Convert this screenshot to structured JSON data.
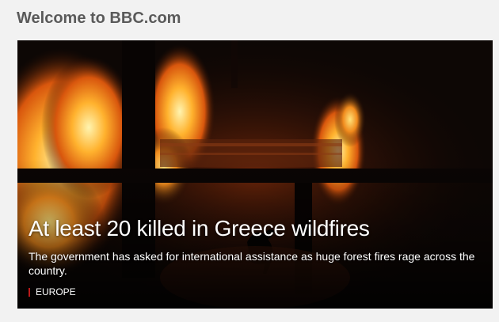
{
  "page": {
    "welcome_title": "Welcome to BBC.com"
  },
  "hero": {
    "image_description": "burning-house-wildfire",
    "headline": "At least 20 killed in Greece wildfires",
    "summary": "The government has asked for international assistance as huge forest fires rage across the country.",
    "section": "EUROPE"
  },
  "colors": {
    "page_background": "#f2f2f2",
    "title_text": "#5a5a5a",
    "section_accent": "#bb1919",
    "hero_text": "#ffffff"
  }
}
